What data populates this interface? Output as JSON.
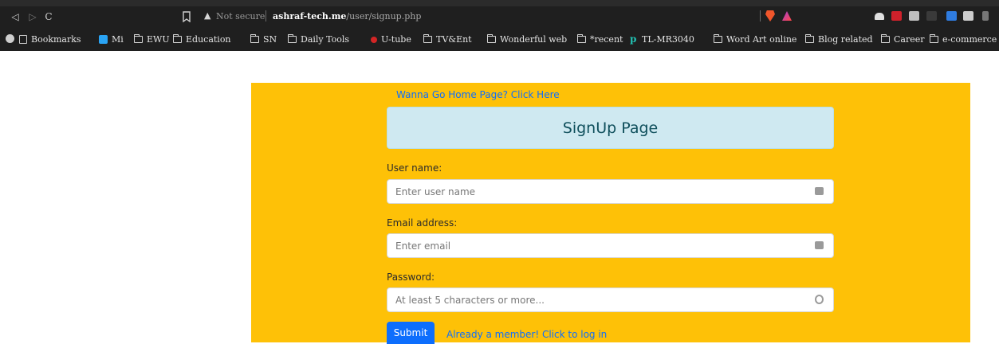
{
  "browser": {
    "security_label": "Not secure",
    "url_host": "ashraf-tech.me",
    "url_path": "/user/signup.php",
    "warning_symbol": "▲",
    "colors": {
      "chrome_bg": "#1f1f1f",
      "brave_orange": "#f1562b"
    }
  },
  "bookmarks": {
    "items": [
      {
        "label": "Bookmarks",
        "icon": "bookmark-manager-icon"
      },
      {
        "label": "Mi",
        "icon": "mi-icon"
      },
      {
        "label": "EWU",
        "icon": "folder-icon"
      },
      {
        "label": "Education",
        "icon": "folder-icon"
      },
      {
        "label": "SN",
        "icon": "folder-icon"
      },
      {
        "label": "Daily Tools",
        "icon": "folder-icon"
      },
      {
        "label": "U-tube",
        "icon": "youtube-icon"
      },
      {
        "label": "TV&Ent",
        "icon": "folder-icon"
      },
      {
        "label": "Wonderful web",
        "icon": "folder-icon"
      },
      {
        "label": "*recent",
        "icon": "folder-icon"
      },
      {
        "label": "TL-MR3040",
        "icon": "tplink-icon"
      },
      {
        "label": "Word Art online",
        "icon": "folder-icon"
      },
      {
        "label": "Blog related",
        "icon": "folder-icon"
      },
      {
        "label": "Career",
        "icon": "folder-icon"
      },
      {
        "label": "e-commerce",
        "icon": "folder-icon"
      }
    ]
  },
  "page": {
    "home_link": "Wanna Go Home Page? Click Here",
    "title": "SignUp Page",
    "username": {
      "label": "User name:",
      "placeholder": "Enter user name"
    },
    "email": {
      "label": "Email address:",
      "placeholder": "Enter email"
    },
    "password": {
      "label": "Password:",
      "placeholder": "At least 5 characters or more..."
    },
    "submit_label": "Submit",
    "login_link": "Already a member! Click to log in",
    "colors": {
      "panel_bg": "#fec107",
      "title_bg": "#cfe9f1",
      "primary": "#0d6efd"
    }
  }
}
